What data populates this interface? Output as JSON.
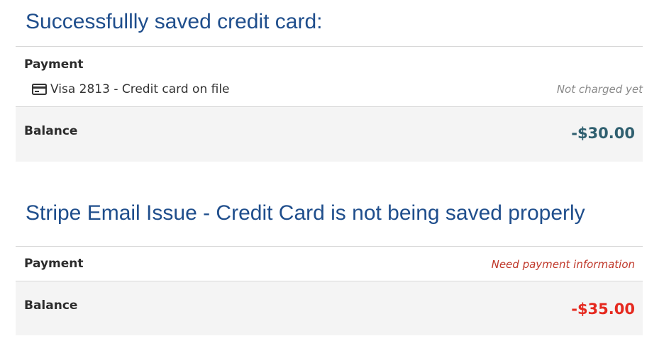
{
  "section_success": {
    "heading": "Successfullly saved credit card:",
    "payment_label": "Payment",
    "card_icon": "credit-card-icon",
    "card_text": "Visa 2813 - Credit card on file",
    "status": "Not charged yet",
    "balance_label": "Balance",
    "balance_amount": "-$30.00",
    "balance_color": "#2f5f6f"
  },
  "section_issue": {
    "heading": "Stripe Email Issue - Credit Card is not being saved properly",
    "payment_label": "Payment",
    "status": "Need payment information",
    "status_color": "#c0392b",
    "balance_label": "Balance",
    "balance_amount": "-$35.00",
    "balance_color": "#e5291f"
  }
}
